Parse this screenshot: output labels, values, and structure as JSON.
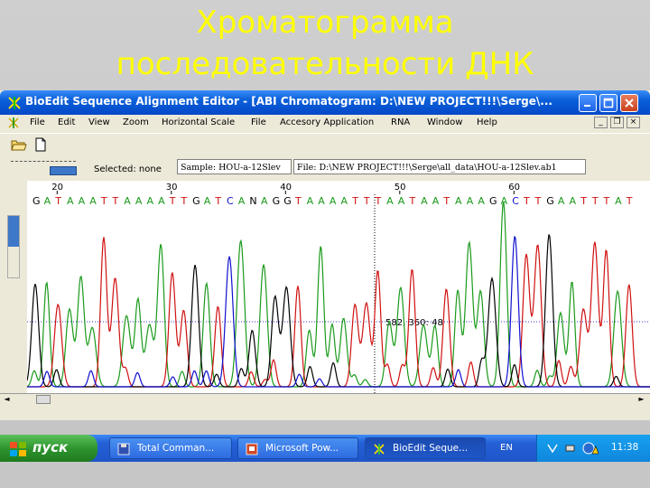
{
  "slide": {
    "title_line1": "Хроматограмма",
    "title_line2": "последовательности ДНК"
  },
  "window": {
    "title": "BioEdit Sequence Alignment Editor - [ABI Chromatogram: D:\\NEW PROJECT!!!\\Serge\\...",
    "menu": [
      "File",
      "Edit",
      "View",
      "Zoom",
      "Horizontal Scale",
      "File",
      "Accesory Application",
      "RNA",
      "Window",
      "Help"
    ],
    "selected_label": "Selected: none",
    "sample_text": "Sample: HOU-a-12Slev",
    "file_text": "File: D:\\NEW PROJECT!!!\\Serge\\all_data\\HOU-a-12Slev.ab1"
  },
  "chromatogram": {
    "position_labels": [
      {
        "label": "20",
        "pos": 20
      },
      {
        "label": "30",
        "pos": 30
      },
      {
        "label": "40",
        "pos": 40
      },
      {
        "label": "50",
        "pos": 50
      },
      {
        "label": "60",
        "pos": 60
      }
    ],
    "sequence": "GATAAATTAAAATTGATCANAGGTAAAATTTAATAATAAAGACTTGAATTTAT",
    "cursor_readout": "582, 360: 48",
    "colors": {
      "A": "#1a9a1a",
      "T": "#d01010",
      "G": "#000000",
      "C": "#1010d0",
      "cursor": "#3a3acc"
    }
  },
  "taskbar": {
    "start_label": "пуск",
    "buttons": [
      {
        "label": "Total Comman..."
      },
      {
        "label": "Microsoft Pow..."
      },
      {
        "label": "BioEdit Seque..."
      }
    ],
    "lang": "EN",
    "clock": "11:38"
  }
}
